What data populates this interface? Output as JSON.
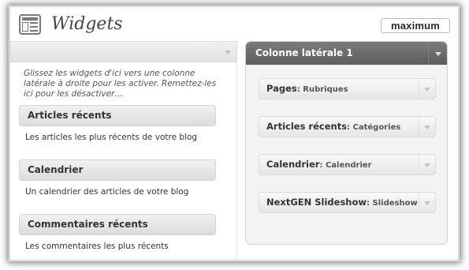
{
  "header": {
    "title": "Widgets",
    "logo_text": "maximum"
  },
  "available": {
    "help_text": "Glissez les widgets d'ici vers une colonne latérale à droite pour les activer. Remettez-les ici pour les désactiver…",
    "widgets": [
      {
        "title": "Articles récents",
        "description": "Les articles les plus récents de votre blog"
      },
      {
        "title": "Calendrier",
        "description": "Un calendrier des articles de votre blog"
      },
      {
        "title": "Commentaires récents",
        "description": "Les commentaires les plus récents"
      }
    ]
  },
  "sidebar": {
    "title": "Colonne latérale 1",
    "widgets": [
      {
        "name": "Pages",
        "instance": "Rubriques"
      },
      {
        "name": "Articles récents",
        "instance": "Catégories"
      },
      {
        "name": "Calendrier",
        "instance": "Calendrier"
      },
      {
        "name": "NextGEN Slideshow",
        "instance": "Slideshow"
      }
    ]
  },
  "colors": {
    "sidebar_header": "#666666",
    "widget_bg": "#e6e6e6"
  }
}
